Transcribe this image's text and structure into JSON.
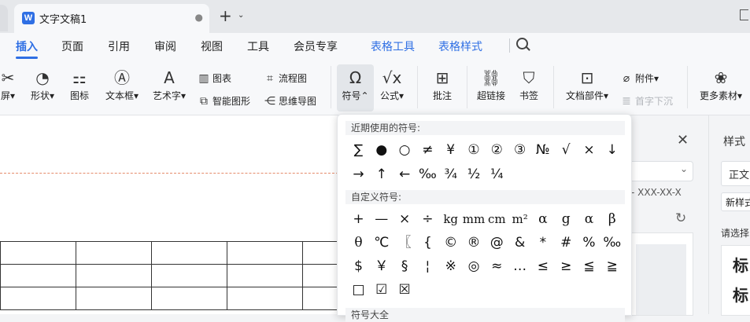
{
  "titlebar": {
    "doc_title": "文字文稿1",
    "app_icon": "W",
    "tab_close": "●",
    "new_tab": "+",
    "new_tab_arrow": "⌄"
  },
  "menu": {
    "items": [
      "插入",
      "页面",
      "引用",
      "审阅",
      "视图",
      "工具",
      "会员专享",
      "表格工具",
      "表格样式"
    ],
    "active": "插入"
  },
  "ribbon": {
    "screenshot_partial": "屏",
    "shape": "形状",
    "icons": "图标",
    "textbox": "文本框",
    "wordart": "艺术字",
    "chart": "图表",
    "smartart": "智能图形",
    "flowchart": "流程图",
    "mindmap": "思维导图",
    "symbol": "符号",
    "formula": "公式",
    "comment": "批注",
    "hyperlink": "超链接",
    "bookmark": "书签",
    "attachment": "附件",
    "doc_parts": "文档部件",
    "drop_cap": "首字下沉",
    "more_materials": "更多素材"
  },
  "symbol_panel": {
    "recent_title": "近期使用的符号:",
    "recent": [
      "∑",
      "●",
      "○",
      "≠",
      "¥",
      "①",
      "②",
      "③",
      "№",
      "√",
      "×",
      "↓",
      "→",
      "↑",
      "←",
      "‰",
      "¾",
      "½",
      "¼"
    ],
    "custom_title": "自定义符号:",
    "custom": [
      "+",
      "—",
      "×",
      "÷",
      "kg",
      "mm",
      "cm",
      "m²",
      "α",
      "g",
      "α",
      "β",
      "θ",
      "℃",
      "〖",
      "{",
      "©",
      "®",
      "@",
      "&",
      "*",
      "#",
      "%",
      "‰",
      "$",
      "￥",
      "§",
      "¦",
      "※",
      "◎",
      "≈",
      "…",
      "≤",
      "≥",
      "≦",
      "≧",
      "□",
      "☑",
      "☒"
    ],
    "next_title": "符号大全"
  },
  "right_panel": {
    "date_text": "- XXX-XX-X"
  },
  "style_panel": {
    "title": "样式",
    "body_style": "正文",
    "new_style": "新样式",
    "choose": "请选择",
    "h1": "标",
    "h2": "标"
  }
}
